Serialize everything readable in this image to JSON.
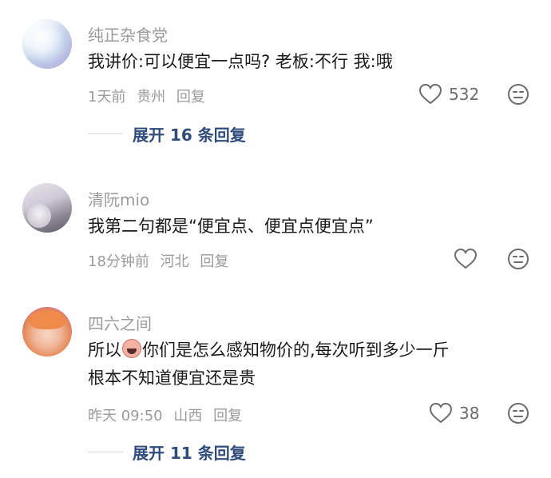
{
  "comments": [
    {
      "username": "纯正杂食党",
      "text": "我讲价:可以便宜一点吗?  老板:不行  我:哦",
      "time": "1天前",
      "location": "贵州",
      "reply": "回复",
      "likes": "532",
      "expand": "展开 16 条回复"
    },
    {
      "username": "清阮mio",
      "text": "我第二句都是“便宜点、便宜点便宜点”",
      "time": "18分钟前",
      "location": "河北",
      "reply": "回复",
      "likes": ""
    },
    {
      "username": "四六之间",
      "text_part1": "所以",
      "text_part2": "你们是怎么感知物价的,每次听到多少一斤",
      "text_line2": "根本不知道便宜还是贵",
      "time": "昨天 09:50",
      "location": "山西",
      "reply": "回复",
      "likes": "38",
      "expand": "展开 11 条回复"
    }
  ],
  "icons": {
    "like": "heart-outline-icon",
    "dislike": "meh-face-icon",
    "inline_emoji": "crying-face-emoji"
  },
  "colors": {
    "username": "#9a9a9f",
    "text": "#1a1a1a",
    "expand": "#2f4b7a",
    "icon": "#6b6b70"
  }
}
